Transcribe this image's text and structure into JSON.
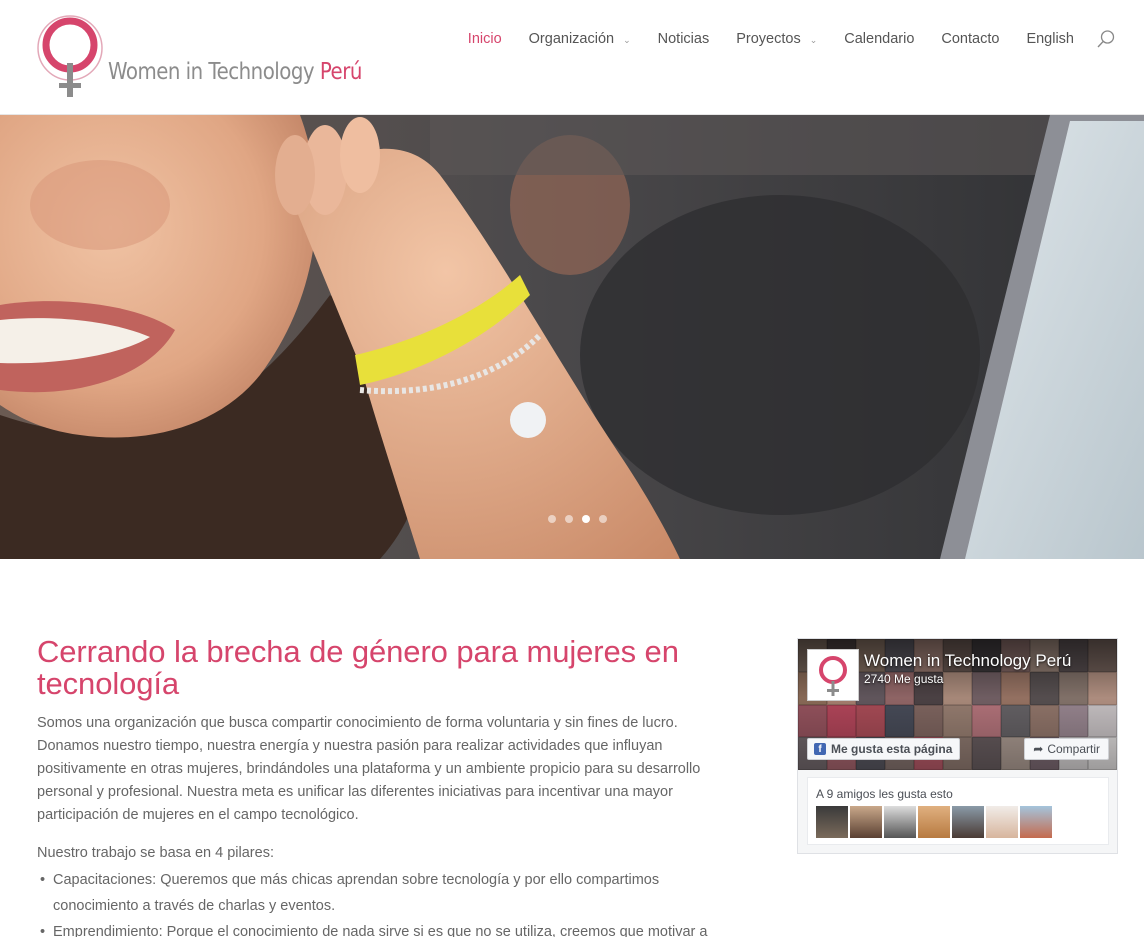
{
  "brand": {
    "logo_text": "Women in Technology",
    "logo_accent": "Perú",
    "accent_color": "#d6456c"
  },
  "nav": {
    "items": [
      {
        "label": "Inicio",
        "active": true,
        "dropdown": false
      },
      {
        "label": "Organización",
        "dropdown": true
      },
      {
        "label": "Noticias",
        "dropdown": false
      },
      {
        "label": "Proyectos",
        "dropdown": true
      },
      {
        "label": "Calendario",
        "dropdown": false
      },
      {
        "label": "Contacto",
        "dropdown": false
      },
      {
        "label": "English",
        "dropdown": false
      }
    ],
    "search_icon": "search-icon"
  },
  "hero": {
    "slides_total": 4,
    "active_slide": 3
  },
  "main": {
    "title": "Cerrando la brecha de género para mujeres en tecnología",
    "intro": "Somos una organización que busca compartir conocimiento de forma voluntaria y sin fines de lucro. Donamos nuestro tiempo, nuestra energía y nuestra pasión para realizar actividades que influyan positivamente en otras mujeres, brindándoles una plataforma y un ambiente propicio para su desarrollo personal y profesional. Nuestra meta es unificar las diferentes iniciativas para incentivar una mayor participación de mujeres en el campo tecnológico.",
    "pillars_heading": "Nuestro trabajo se basa en 4 pilares:",
    "pillars": [
      "Capacitaciones: Queremos que más chicas aprendan sobre tecnología y por ello compartimos conocimiento a través de charlas y eventos.",
      "Emprendimiento: Porque el conocimiento de nada sirve si es que no se utiliza, creemos que motivar a"
    ]
  },
  "facebook": {
    "page_name": "Women in Technology Perú",
    "likes": "2740 Me gusta",
    "like_button": "Me gusta esta página",
    "share_button": "Compartir",
    "friends_text": "A 9 amigos les gusta esto",
    "brand_color": "#4267b2"
  }
}
